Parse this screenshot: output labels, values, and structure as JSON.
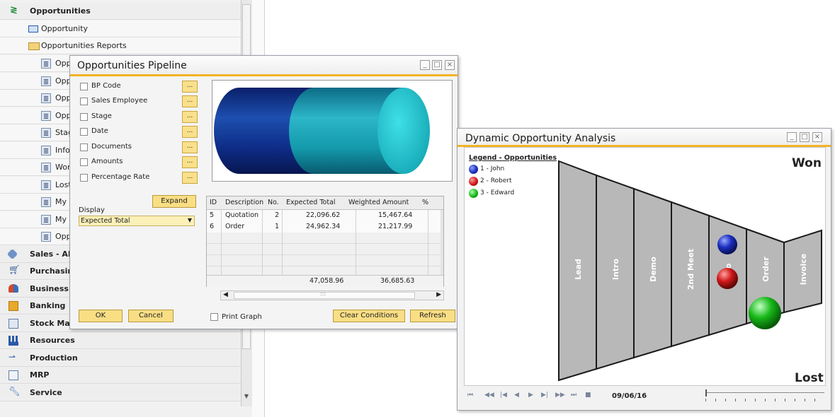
{
  "nav": {
    "header": "Opportunities",
    "items": [
      {
        "label": "Opportunity"
      },
      {
        "label": "Opportunities Reports"
      }
    ],
    "reports": [
      "Opp",
      "Opp",
      "Opp",
      "Stag",
      "Info",
      "Wor",
      "Lost",
      "My (",
      "My (",
      "Opp"
    ],
    "modules": [
      "Sales - AR",
      "Purchasin",
      "Business I",
      "Banking",
      "Stock Mar",
      "Resources",
      "Production",
      "MRP",
      "Service"
    ]
  },
  "pipeline": {
    "title": "Opportunities Pipeline",
    "criteria": [
      "BP Code",
      "Sales Employee",
      "Stage",
      "Date",
      "Documents",
      "Amounts",
      "Percentage Rate"
    ],
    "dots_label": "...",
    "expand_label": "Expand",
    "display_label": "Display",
    "display_value": "Expected Total",
    "table": {
      "headers": [
        "ID",
        "Description",
        "No.",
        "Expected Total",
        "Weighted Amount",
        "%"
      ],
      "rows": [
        [
          "5",
          "Quotation",
          "2",
          "22,096.62",
          "15,467.64",
          ""
        ],
        [
          "6",
          "Order",
          "1",
          "24,962.34",
          "21,217.99",
          ""
        ]
      ],
      "totals": [
        "47,058.96",
        "36,685.63"
      ]
    },
    "scroll_grip": ":::",
    "print_graph_label": "Print Graph",
    "ok_label": "OK",
    "cancel_label": "Cancel",
    "clear_label": "Clear Conditions",
    "refresh_label": "Refresh"
  },
  "dynamic": {
    "title": "Dynamic Opportunity Analysis",
    "legend_title": "Legend - Opportunities",
    "legend": [
      {
        "label": "1 - John",
        "color": "#1c2fbf"
      },
      {
        "label": "2 - Robert",
        "color": "#d01818"
      },
      {
        "label": "3 - Edward",
        "color": "#18b818"
      }
    ],
    "won_label": "Won",
    "lost_label": "Lost",
    "stages": [
      "Lead",
      "Intro",
      "Demo",
      "2nd Meet",
      "tio",
      "Order",
      "Invoice"
    ],
    "date": "09/06/16"
  },
  "colors": {
    "accent": "#f2b324",
    "button_yellow": "#f9de84",
    "funnel_gray": "#b8b8b8",
    "cylinder_dark": "#0b2d8f",
    "cylinder_light": "#1fc0c8"
  }
}
